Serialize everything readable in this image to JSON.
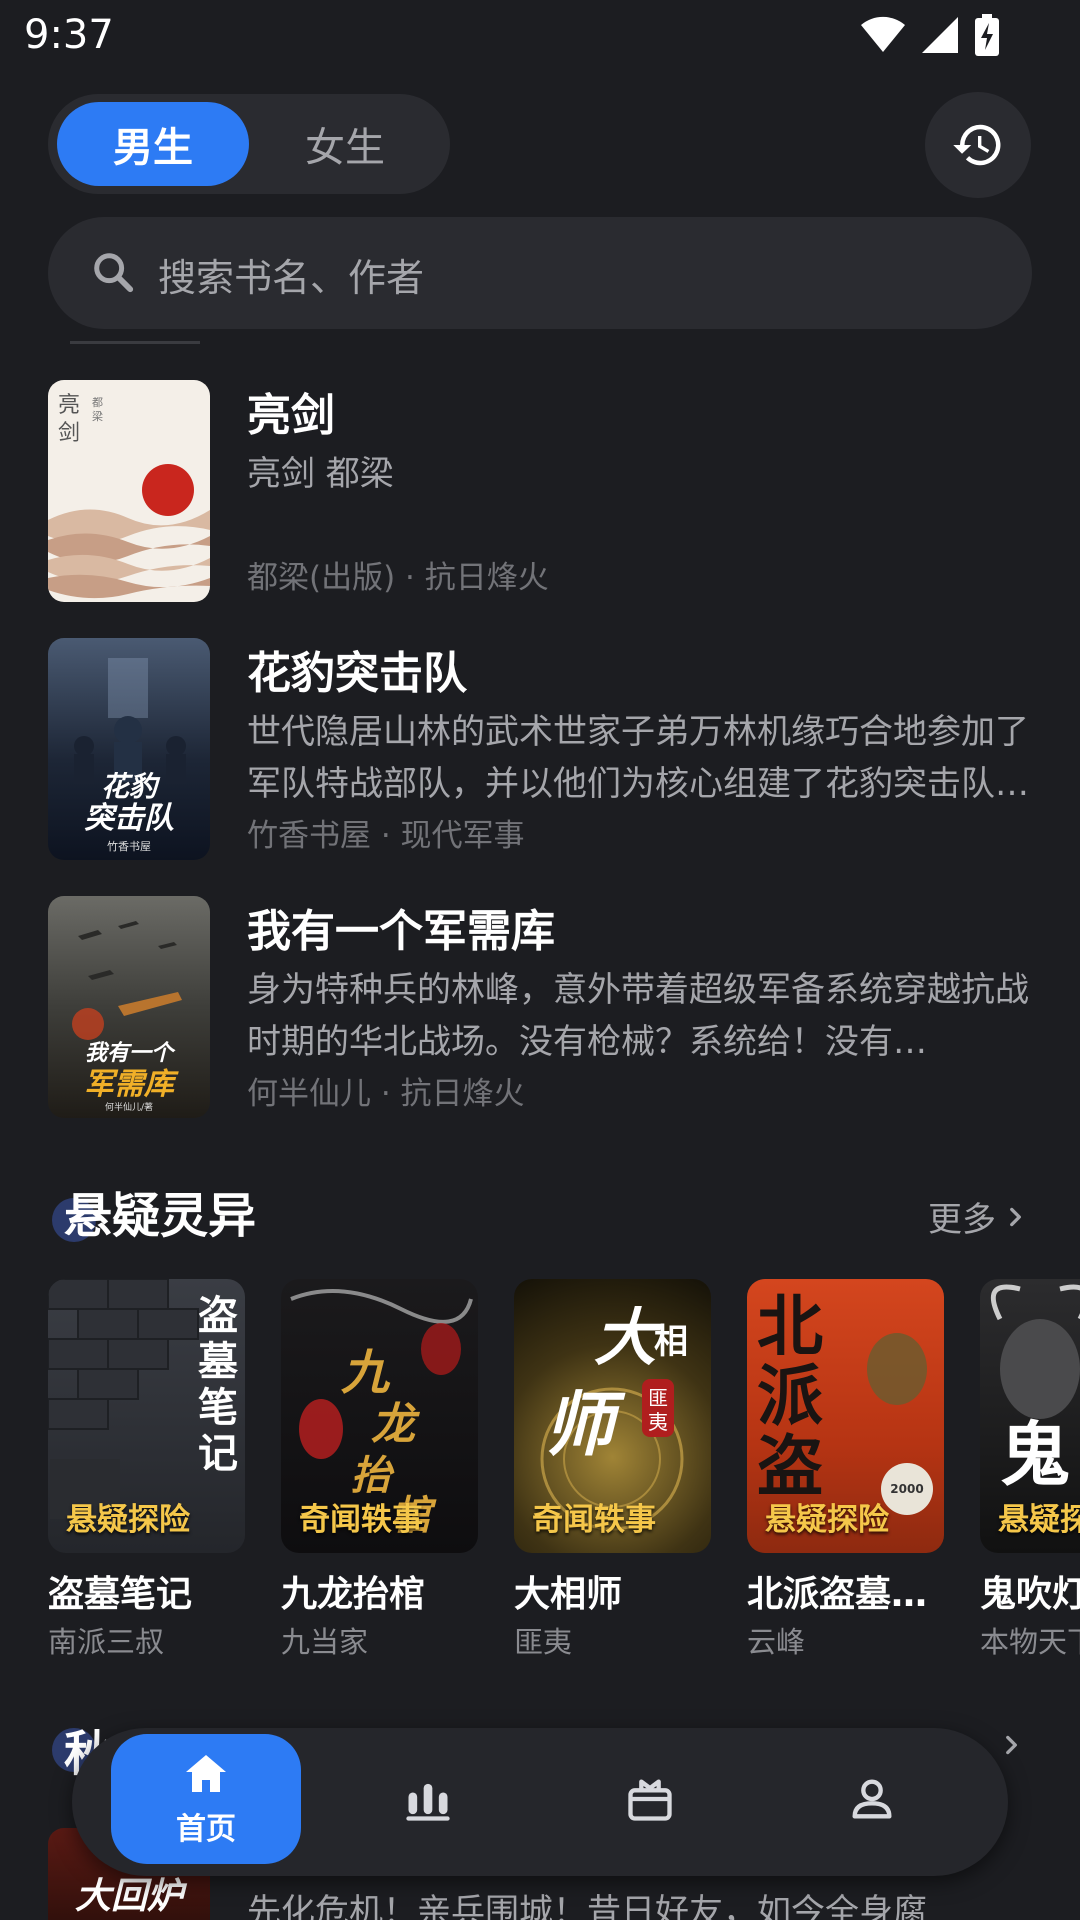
{
  "status": {
    "time": "9:37"
  },
  "header": {
    "tabs": [
      {
        "label": "男生",
        "active": true
      },
      {
        "label": "女生",
        "active": false
      }
    ],
    "history_icon": "history-icon"
  },
  "search": {
    "placeholder": "搜索书名、作者"
  },
  "book_list": [
    {
      "title": "亮剑",
      "description": "亮剑 都梁",
      "meta": "都梁(出版) · 抗日烽火",
      "cover_text": "亮剑"
    },
    {
      "title": "花豹突击队",
      "description": "世代隐居山林的武术世家子弟万林机缘巧合地参加了军队特战部队，并以他们为核心组建了花豹突击队…",
      "meta": "竹香书屋 · 现代军事",
      "cover_text": "花豹突击队"
    },
    {
      "title": "我有一个军需库",
      "description": "身为特种兵的林峰，意外带着超级军备系统穿越抗战时期的华北战场。没有枪械？系统给！没有…",
      "meta": "何半仙儿 · 抗日烽火",
      "cover_text": "我有一个军需库"
    }
  ],
  "section": {
    "title": "悬疑灵异",
    "more_label": "更多",
    "books": [
      {
        "title": "盗墓笔记",
        "author": "南派三叔",
        "tag": "悬疑探险",
        "cover_text": "盗墓笔记"
      },
      {
        "title": "九龙抬棺",
        "author": "九当家",
        "tag": "奇闻轶事",
        "cover_text": "九龙抬棺"
      },
      {
        "title": "大相师",
        "author": "匪夷",
        "tag": "奇闻轶事",
        "cover_text": "大相师"
      },
      {
        "title": "北派盗墓…",
        "author": "云峰",
        "tag": "悬疑探险",
        "cover_text": "北派"
      },
      {
        "title": "鬼吹灯",
        "author": "本物天下",
        "tag": "悬疑探险",
        "cover_text": "鬼"
      }
    ]
  },
  "next_section": {
    "title": "秋",
    "cover_text": "大回炉",
    "first_description": "先化危机！亲兵围城！昔日好友，如今全身腐"
  },
  "bottom_nav": {
    "items": [
      {
        "label": "首页",
        "icon": "home-icon",
        "active": true
      },
      {
        "label": "",
        "icon": "rank-icon",
        "active": false
      },
      {
        "label": "",
        "icon": "gift-icon",
        "active": false
      },
      {
        "label": "",
        "icon": "profile-icon",
        "active": false
      }
    ]
  },
  "colors": {
    "accent": "#2d7bf4",
    "background": "#1c1d21",
    "tag": "#f5c74a"
  }
}
